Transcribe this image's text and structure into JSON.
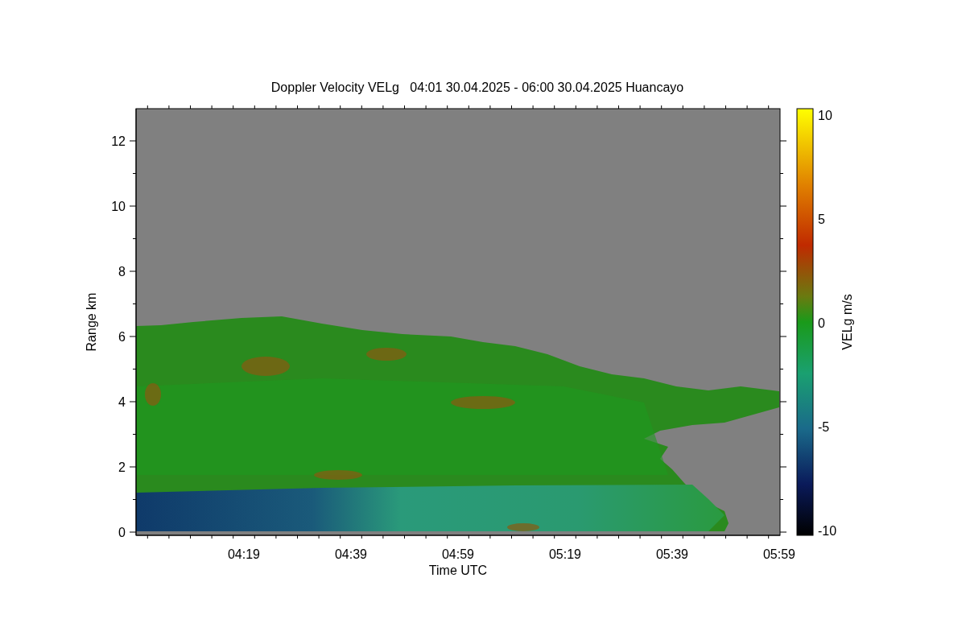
{
  "title": "Doppler Velocity VELg   04:01 30.04.2025 - 06:00 30.04.2025 Huancayo",
  "y_axis": {
    "label": "Range km",
    "ticks": [
      "12",
      "10",
      "8",
      "6",
      "4",
      "2",
      "0"
    ]
  },
  "x_axis": {
    "label": "Time UTC",
    "ticks": [
      "04:19",
      "04:39",
      "04:59",
      "05:19",
      "05:39",
      "05:59"
    ]
  },
  "colorbar": {
    "label": "VELg m/s",
    "ticks": [
      "10",
      "5",
      "0",
      "-5",
      "-10"
    ]
  }
}
